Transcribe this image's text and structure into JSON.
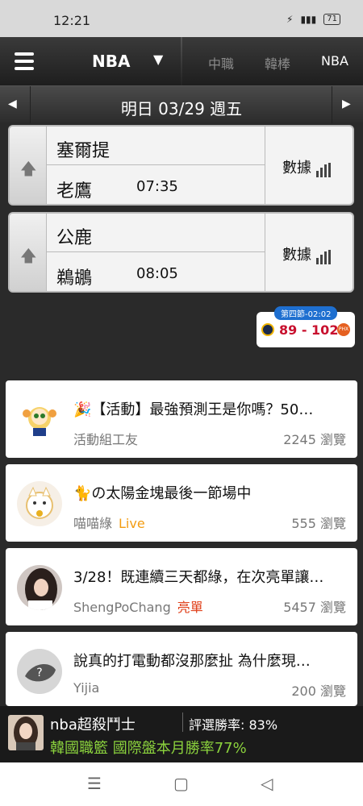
{
  "status_bar": {
    "time": "12:21",
    "battery": "71"
  },
  "top_nav": {
    "title": "NBA",
    "tabs": [
      {
        "label": "中職",
        "active": false
      },
      {
        "label": "韓棒",
        "active": false
      },
      {
        "label": "NBA",
        "active": true
      }
    ]
  },
  "date_bar": {
    "date": "明日 03/29 週五"
  },
  "games": [
    {
      "away": "塞爾提",
      "home": "老鷹",
      "time": "07:35",
      "stats_label": "數據"
    },
    {
      "away": "公鹿",
      "home": "鵜鶘",
      "time": "08:05",
      "stats_label": "數據"
    }
  ],
  "live_score": {
    "period": "第四節-02:02",
    "score": "89 - 102",
    "home_logo_text": "PHX"
  },
  "posts": [
    {
      "title": "🎉【活動】最強預測王是你嗎？50…",
      "author": "活動組工友",
      "tag": "",
      "views": "2245 瀏覽"
    },
    {
      "title": "🐈の太陽金塊最後一節場中",
      "author": "喵喵綠",
      "tag": "Live",
      "views": "555 瀏覽"
    },
    {
      "title": "3/28！既連續三天都綠，在次亮單讓…",
      "author": "ShengPoChang",
      "tag": "亮單",
      "views": "5457 瀏覽"
    },
    {
      "title": "說真的打電動都沒那麼扯  為什麼現…",
      "author": "Yijia",
      "tag": "",
      "views": "200 瀏覽"
    }
  ],
  "recommend": {
    "name": "nba超殺鬥士",
    "win_rate": "評選勝率: 83%",
    "description": "韓國職籃 國際盤本月勝率77%"
  },
  "colors": {
    "accent_blue": "#1e6fd0",
    "score_red": "#c8102e",
    "live_orange": "#f39c12",
    "pick_red": "#e0401a",
    "rec_green": "#8bd23d"
  }
}
